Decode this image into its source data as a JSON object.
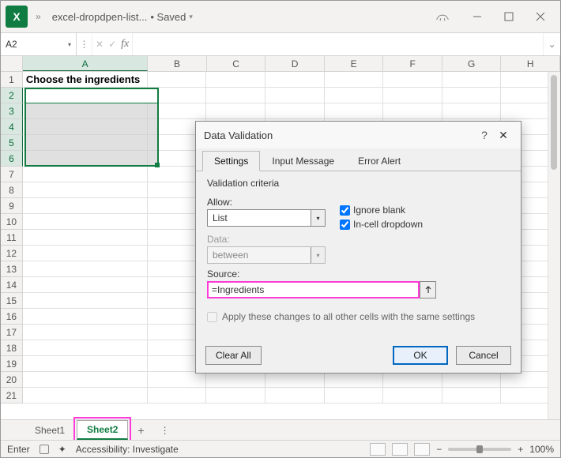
{
  "title": {
    "docname": "excel-dropdpen-list...",
    "saved": "• Saved"
  },
  "namebox": {
    "value": "A2"
  },
  "fx": {
    "cross": "✕",
    "check": "✓",
    "label": "fx",
    "expand": "⌄"
  },
  "columns": [
    "A",
    "B",
    "C",
    "D",
    "E",
    "F",
    "G",
    "H"
  ],
  "rows": [
    "1",
    "2",
    "3",
    "4",
    "5",
    "6",
    "7",
    "8",
    "9",
    "10",
    "11",
    "12",
    "13",
    "14",
    "15",
    "16",
    "17",
    "18",
    "19",
    "20",
    "21"
  ],
  "cells": {
    "A1": "Choose the ingredients"
  },
  "sheets": {
    "s1": "Sheet1",
    "s2": "Sheet2",
    "plus": "+",
    "menu": "⋮"
  },
  "status": {
    "mode": "Enter",
    "acc": "Accessibility: Investigate",
    "zoom_minus": "−",
    "zoom_plus": "+",
    "zoom": "100%"
  },
  "dialog": {
    "title": "Data Validation",
    "help": "?",
    "close": "✕",
    "tabs": {
      "settings": "Settings",
      "inputmsg": "Input Message",
      "erralert": "Error Alert"
    },
    "criteria_label": "Validation criteria",
    "allow_label": "Allow:",
    "allow_value": "List",
    "data_label": "Data:",
    "data_value": "between",
    "ignore_blank": "Ignore blank",
    "incell_dd": "In-cell dropdown",
    "source_label": "Source:",
    "source_value": "=Ingredients",
    "apply_label": "Apply these changes to all other cells with the same settings",
    "btn_clear": "Clear All",
    "btn_ok": "OK",
    "btn_cancel": "Cancel"
  }
}
